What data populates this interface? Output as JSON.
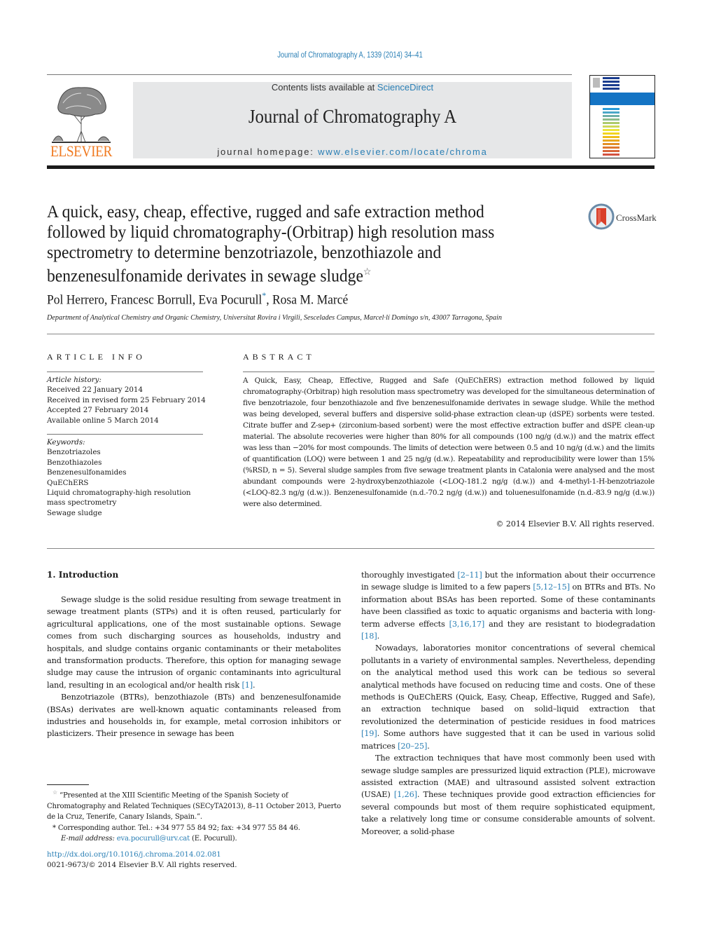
{
  "header": {
    "citation": "Journal of Chromatography A, 1339 (2014) 34–41",
    "publisher_logo_text": "ELSEVIER",
    "contents_prefix": "Contents lists available at ",
    "contents_link": "ScienceDirect",
    "journal_name": "Journal of Chromatography A",
    "homepage_prefix": "journal homepage: ",
    "homepage_link": "www.elsevier.com/locate/chroma",
    "crossmark_label": "CrossMark",
    "colors": {
      "link": "#2a7fb5",
      "elsevier_orange": "#f07a21",
      "cover_band": "#1474c4"
    }
  },
  "article": {
    "title": "A quick, easy, cheap, effective, rugged and safe extraction method followed by liquid chromatography-(Orbitrap) high resolution mass spectrometry to determine benzotriazole, benzothiazole and benzenesulfonamide derivates in sewage sludge",
    "title_mark": "☆",
    "authors": {
      "a1": "Pol Herrero, ",
      "a2": "Francesc Borrull, ",
      "a3": "Eva Pocurull",
      "a3_mark": "*",
      "a4": ", Rosa M. Marcé"
    },
    "affiliation": "Department of Analytical Chemistry and Organic Chemistry, Universitat Rovira i Virgili, Sescelades Campus, Marcel·lí Domingo s/n, 43007 Tarragona, Spain"
  },
  "article_info": {
    "heading": "ARTICLE INFO",
    "history_label": "Article history:",
    "history": [
      "Received 22 January 2014",
      "Received in revised form 25 February 2014",
      "Accepted 27 February 2014",
      "Available online 5 March 2014"
    ],
    "keywords_label": "Keywords:",
    "keywords": [
      "Benzotriazoles",
      "Benzothiazoles",
      "Benzenesulfonamides",
      "QuEChERS",
      "Liquid chromatography-high resolution",
      "mass spectrometry",
      "Sewage sludge"
    ]
  },
  "abstract": {
    "heading": "ABSTRACT",
    "text": "A Quick, Easy, Cheap, Effective, Rugged and Safe (QuEChERS) extraction method followed by liquid chromatography-(Orbitrap) high resolution mass spectrometry was developed for the simultaneous determination of five benzotriazole, four benzothiazole and five benzenesulfonamide derivates in sewage sludge. While the method was being developed, several buffers and dispersive solid-phase extraction clean-up (dSPE) sorbents were tested. Citrate buffer and Z-sep+ (zirconium-based sorbent) were the most effective extraction buffer and dSPE clean-up material. The absolute recoveries were higher than 80% for all compounds (100 ng/g (d.w.)) and the matrix effect was less than −20% for most compounds. The limits of detection were between 0.5 and 10 ng/g (d.w.) and the limits of quantification (LOQ) were between 1 and 25 ng/g (d.w.). Repeatability and reproducibility were lower than 15% (%RSD, n = 5). Several sludge samples from five sewage treatment plants in Catalonia were analysed and the most abundant compounds were 2-hydroxybenzothiazole (<LOQ-181.2 ng/g (d.w.)) and 4-methyl-1-H-benzotriazole (<LOQ-82.3 ng/g (d.w.)). Benzenesulfonamide (n.d.-70.2 ng/g (d.w.)) and toluenesulfonamide (n.d.-83.9 ng/g (d.w.)) were also determined.",
    "copyright": "© 2014 Elsevier B.V. All rights reserved."
  },
  "body": {
    "section_heading": "1.  Introduction",
    "left": {
      "p1a": "Sewage sludge is the solid residue resulting from sewage treatment in sewage treatment plants (STPs) and it is often reused, particularly for agricultural applications, one of the most sustainable options. Sewage comes from such discharging sources as households, industry and hospitals, and sludge contains organic contaminants or their metabolites and transformation products. Therefore, this option for managing sewage sludge may cause the intrusion of organic contaminants into agricultural land, resulting in an ecological and/or health risk ",
      "p1ref": "[1]",
      "p1b": ".",
      "p2": "Benzotriazole (BTRs), benzothiazole (BTs) and benzenesulfonamide (BSAs) derivates are well-known aquatic contaminants released from industries and households in, for example, metal corrosion inhibitors or plasticizers. Their presence in sewage has been"
    },
    "right": {
      "p1a": "thoroughly investigated ",
      "p1r1": "[2–11]",
      "p1b": " but the information about their occurrence in sewage sludge is limited to a few papers ",
      "p1r2": "[5,12–15]",
      "p1c": " on BTRs and BTs. No information about BSAs has been reported. Some of these contaminants have been classified as toxic to aquatic organisms and bacteria with long-term adverse effects ",
      "p1r3": "[3,16,17]",
      "p1d": " and they are resistant to biodegradation ",
      "p1r4": "[18]",
      "p1e": ".",
      "p2a": "Nowadays, laboratories monitor concentrations of several chemical pollutants in a variety of environmental samples. Nevertheless, depending on the analytical method used this work can be tedious so several analytical methods have focused on reducing time and costs. One of these methods is QuEChERS (Quick, Easy, Cheap, Effective, Rugged and Safe), an extraction technique based on solid–liquid extraction that revolutionized the determination of pesticide residues in food matrices ",
      "p2r1": "[19]",
      "p2b": ". Some authors have suggested that it can be used in various solid matrices ",
      "p2r2": "[20–25]",
      "p2c": ".",
      "p3a": "The extraction techniques that have most commonly been used with sewage sludge samples are pressurized liquid extraction (PLE), microwave assisted extraction (MAE) and ultrasound assisted solvent extraction (USAE) ",
      "p3r1": "[1,26]",
      "p3b": ". These techniques provide good extraction efficiencies for several compounds but most of them require sophisticated equipment, take a relatively long time or consume considerable amounts of solvent. Moreover, a solid-phase"
    }
  },
  "footnotes": {
    "star_mark": "☆",
    "star_text": " “Presented at the XIII Scientific Meeting of the Spanish Society of Chromatography and Related Techniques (SECyTA2013), 8–11 October 2013, Puerto de la Cruz, Tenerife, Canary Islands, Spain.”.",
    "corr_mark": "*",
    "corr_text": " Corresponding author. Tel.: +34 977 55 84 92; fax: +34 977 55 84 46.",
    "email_label": "E-mail address: ",
    "email": "eva.pocurull@urv.cat",
    "email_suffix": " (E. Pocurull).",
    "doi": "http://dx.doi.org/10.1016/j.chroma.2014.02.081",
    "issn": "0021-9673/© 2014 Elsevier B.V. All rights reserved."
  }
}
